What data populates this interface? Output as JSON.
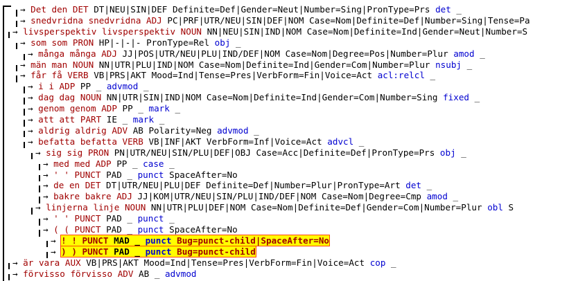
{
  "tree": {
    "rows": [
      {
        "form": "Det",
        "lemma": "den",
        "upos": "DET",
        "xpos": "DT|NEU|SIN|DEF",
        "feats": "Definite=Def|Gender=Neut|Number=Sing|PronType=Prs",
        "deprel": "det",
        "misc": "_",
        "depth": 1,
        "highlight": false
      },
      {
        "form": "snedvridna",
        "lemma": "snedvridna",
        "upos": "ADJ",
        "xpos": "PC|PRF|UTR/NEU|SIN|DEF|NOM",
        "feats": "Case=Nom|Definite=Def|Number=Sing|Tense=Pa",
        "deprel": "",
        "misc": "",
        "depth": 1,
        "highlight": false
      },
      {
        "form": "livsperspektiv",
        "lemma": "livsperspektiv",
        "upos": "NOUN",
        "xpos": "NN|NEU|SIN|IND|NOM",
        "feats": "Case=Nom|Definite=Ind|Gender=Neut|Number=S",
        "deprel": "",
        "misc": "",
        "depth": 0,
        "highlight": false
      },
      {
        "form": "som",
        "lemma": "som",
        "upos": "PRON",
        "xpos": "HP|-|-|-",
        "feats": "PronType=Rel",
        "deprel": "obj",
        "misc": "_",
        "depth": 1,
        "highlight": false
      },
      {
        "form": "många",
        "lemma": "många",
        "upos": "ADJ",
        "xpos": "JJ|POS|UTR/NEU|PLU|IND/DEF|NOM",
        "feats": "Case=Nom|Degree=Pos|Number=Plur",
        "deprel": "amod",
        "misc": "_",
        "depth": 2,
        "highlight": false
      },
      {
        "form": "män",
        "lemma": "man",
        "upos": "NOUN",
        "xpos": "NN|UTR|PLU|IND|NOM",
        "feats": "Case=Nom|Definite=Ind|Gender=Com|Number=Plur",
        "deprel": "nsubj",
        "misc": "_",
        "depth": 1,
        "highlight": false
      },
      {
        "form": "får",
        "lemma": "få",
        "upos": "VERB",
        "xpos": "VB|PRS|AKT",
        "feats": "Mood=Ind|Tense=Pres|VerbForm=Fin|Voice=Act",
        "deprel": "acl:relcl",
        "misc": "_",
        "depth": 1,
        "highlight": false
      },
      {
        "form": "i",
        "lemma": "i",
        "upos": "ADP",
        "xpos": "PP",
        "feats": "_",
        "deprel": "advmod",
        "misc": "_",
        "depth": 2,
        "highlight": false
      },
      {
        "form": "dag",
        "lemma": "dag",
        "upos": "NOUN",
        "xpos": "NN|UTR|SIN|IND|NOM",
        "feats": "Case=Nom|Definite=Ind|Gender=Com|Number=Sing",
        "deprel": "fixed",
        "misc": "_",
        "depth": 2,
        "highlight": false
      },
      {
        "form": "genom",
        "lemma": "genom",
        "upos": "ADP",
        "xpos": "PP",
        "feats": "_",
        "deprel": "mark",
        "misc": "_",
        "depth": 2,
        "highlight": false
      },
      {
        "form": "att",
        "lemma": "att",
        "upos": "PART",
        "xpos": "IE",
        "feats": "_",
        "deprel": "mark",
        "misc": "_",
        "depth": 2,
        "highlight": false
      },
      {
        "form": "aldrig",
        "lemma": "aldrig",
        "upos": "ADV",
        "xpos": "AB",
        "feats": "Polarity=Neg",
        "deprel": "advmod",
        "misc": "_",
        "depth": 2,
        "highlight": false
      },
      {
        "form": "befatta",
        "lemma": "befatta",
        "upos": "VERB",
        "xpos": "VB|INF|AKT",
        "feats": "VerbForm=Inf|Voice=Act",
        "deprel": "advcl",
        "misc": "_",
        "depth": 2,
        "highlight": false
      },
      {
        "form": "sig",
        "lemma": "sig",
        "upos": "PRON",
        "xpos": "PN|UTR/NEU|SIN/PLU|DEF|OBJ",
        "feats": "Case=Acc|Definite=Def|PronType=Prs",
        "deprel": "obj",
        "misc": "_",
        "depth": 3,
        "highlight": false
      },
      {
        "form": "med",
        "lemma": "med",
        "upos": "ADP",
        "xpos": "PP",
        "feats": "_",
        "deprel": "case",
        "misc": "_",
        "depth": 4,
        "highlight": false
      },
      {
        "form": "'",
        "lemma": "'",
        "upos": "PUNCT",
        "xpos": "PAD",
        "feats": "_",
        "deprel": "punct",
        "misc": "SpaceAfter=No",
        "depth": 4,
        "highlight": false
      },
      {
        "form": "de",
        "lemma": "en",
        "upos": "DET",
        "xpos": "DT|UTR/NEU|PLU|DEF",
        "feats": "Definite=Def|Number=Plur|PronType=Art",
        "deprel": "det",
        "misc": "_",
        "depth": 4,
        "highlight": false
      },
      {
        "form": "bakre",
        "lemma": "bakre",
        "upos": "ADJ",
        "xpos": "JJ|KOM|UTR/NEU|SIN/PLU|IND/DEF|NOM",
        "feats": "Case=Nom|Degree=Cmp",
        "deprel": "amod",
        "misc": "_",
        "depth": 4,
        "highlight": false
      },
      {
        "form": "linjerna",
        "lemma": "linje",
        "upos": "NOUN",
        "xpos": "NN|UTR|PLU|DEF|NOM",
        "feats": "Case=Nom|Definite=Def|Gender=Com|Number=Plur",
        "deprel": "obl",
        "misc": "S",
        "depth": 3,
        "highlight": false
      },
      {
        "form": "'",
        "lemma": "'",
        "upos": "PUNCT",
        "xpos": "PAD",
        "feats": "_",
        "deprel": "punct",
        "misc": "_",
        "depth": 4,
        "highlight": false
      },
      {
        "form": "(",
        "lemma": "(",
        "upos": "PUNCT",
        "xpos": "PAD",
        "feats": "_",
        "deprel": "punct",
        "misc": "SpaceAfter=No",
        "depth": 4,
        "highlight": false
      },
      {
        "form": "!",
        "lemma": "!",
        "upos": "PUNCT",
        "xpos": "MAD",
        "feats": "_",
        "deprel": "punct",
        "misc": "Bug=punct-child|SpaceAfter=No",
        "depth": 5,
        "highlight": true
      },
      {
        "form": ")",
        "lemma": ")",
        "upos": "PUNCT",
        "xpos": "PAD",
        "feats": "_",
        "deprel": "punct",
        "misc": "Bug=punct-child",
        "depth": 5,
        "highlight": true
      },
      {
        "form": "är",
        "lemma": "vara",
        "upos": "AUX",
        "xpos": "VB|PRS|AKT",
        "feats": "Mood=Ind|Tense=Pres|VerbForm=Fin|Voice=Act",
        "deprel": "cop",
        "misc": "_",
        "depth": 0,
        "highlight": false
      },
      {
        "form": "förvisso",
        "lemma": "förvisso",
        "upos": "ADV",
        "xpos": "AB",
        "feats": "_",
        "deprel": "advmod",
        "misc": "",
        "depth": 0,
        "highlight": false
      }
    ]
  }
}
